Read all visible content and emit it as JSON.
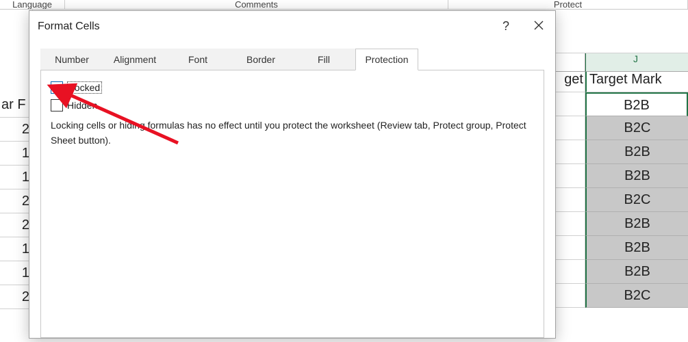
{
  "ribbon": {
    "group_language": "Language",
    "group_comments": "Comments",
    "group_protect": "Protect"
  },
  "sheet_left": {
    "header_fragment": "ar F",
    "rows": [
      "2",
      "1",
      "1",
      "2",
      "2",
      "1",
      "1",
      "2"
    ]
  },
  "sheet_right": {
    "col_i_header_fragment": "get",
    "col_j_letter": "J",
    "col_j_header": "Target Mark",
    "rows": [
      "B2B",
      "B2C",
      "B2B",
      "B2B",
      "B2C",
      "B2B",
      "B2B",
      "B2B",
      "B2C"
    ]
  },
  "dialog": {
    "title": "Format Cells",
    "help": "?",
    "close": "✕",
    "tabs": [
      "Number",
      "Alignment",
      "Font",
      "Border",
      "Fill",
      "Protection"
    ],
    "active_tab": "Protection",
    "locked_label": "Locked",
    "locked_checked": true,
    "hidden_label": "Hidden",
    "hidden_checked": false,
    "helptext": "Locking cells or hiding formulas has no effect until you protect the worksheet (Review tab, Protect group, Protect Sheet button)."
  }
}
